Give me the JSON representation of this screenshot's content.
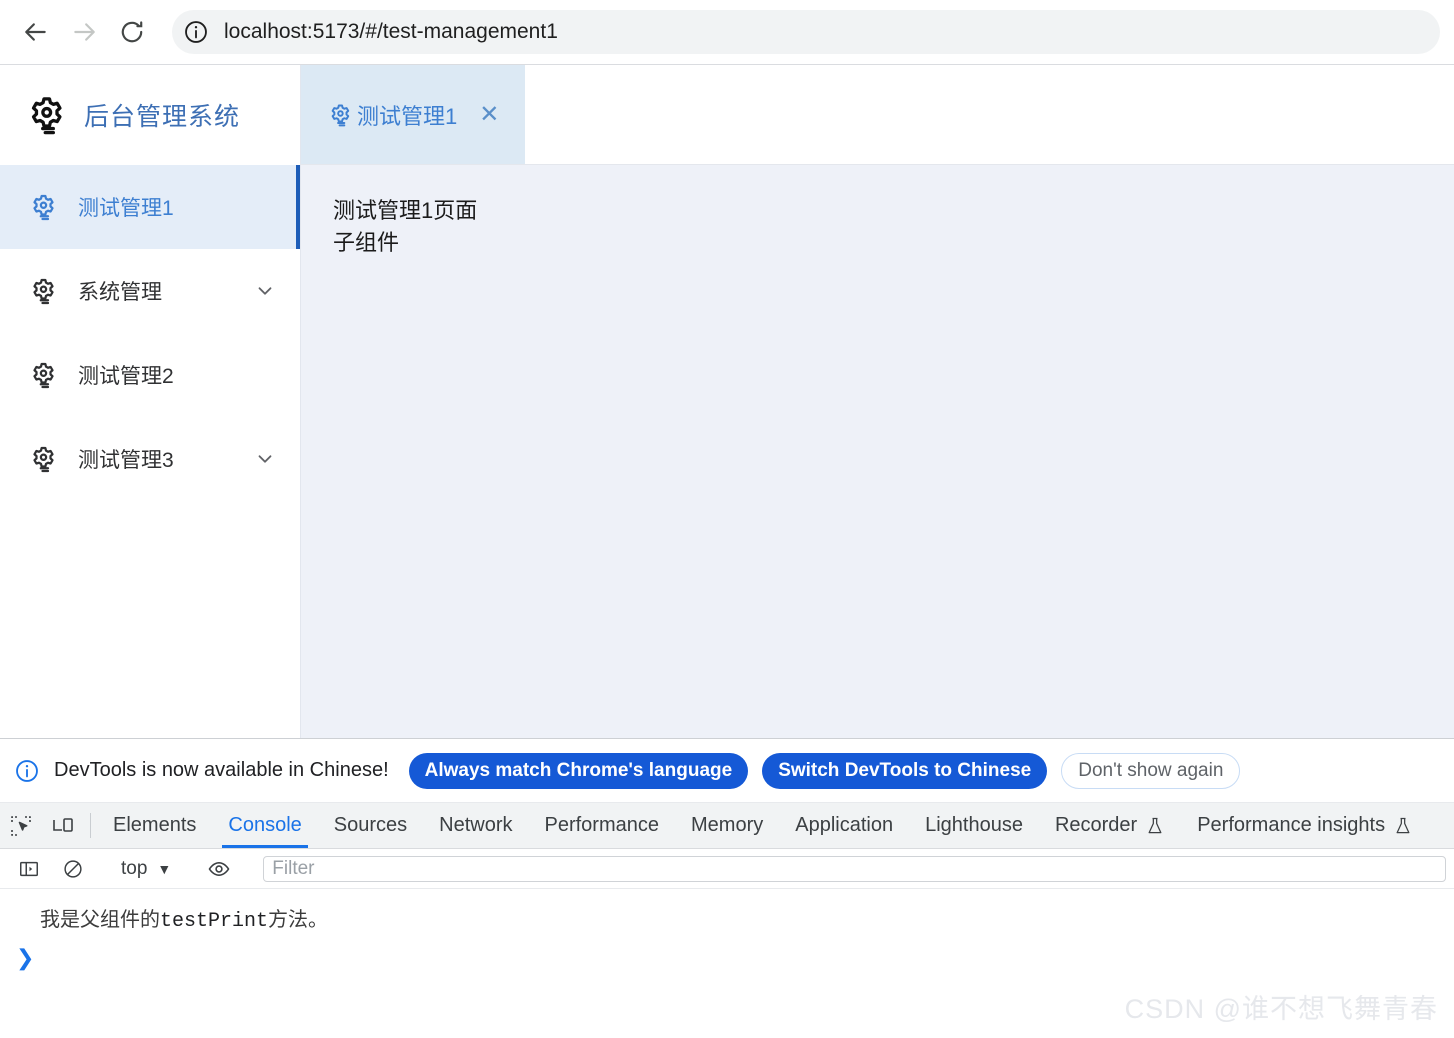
{
  "browser": {
    "back_icon": "arrow-left-icon",
    "forward_icon": "arrow-right-icon",
    "reload_icon": "reload-icon",
    "site_info_icon": "info-circle-icon",
    "url": "localhost:5173/#/test-management1"
  },
  "sidebar": {
    "logo_icon": "gear-settings-icon",
    "title": "后台管理系统",
    "items": [
      {
        "label": "测试管理1",
        "icon": "gear-settings-icon",
        "active": true,
        "has_chevron": false
      },
      {
        "label": "系统管理",
        "icon": "gear-settings-icon",
        "active": false,
        "has_chevron": true
      },
      {
        "label": "测试管理2",
        "icon": "gear-settings-icon",
        "active": false,
        "has_chevron": false
      },
      {
        "label": "测试管理3",
        "icon": "gear-settings-icon",
        "active": false,
        "has_chevron": true
      }
    ]
  },
  "tabs": {
    "items": [
      {
        "label": "测试管理1",
        "icon": "gear-settings-icon",
        "close_label": "✕",
        "active": true
      }
    ]
  },
  "content": {
    "line1": "测试管理1页面",
    "line2": "子组件"
  },
  "devtools": {
    "notice": {
      "icon": "info-circle-icon",
      "text": "DevTools is now available in Chinese!",
      "buttons": [
        {
          "label": "Always match Chrome's language",
          "style": "primary"
        },
        {
          "label": "Switch DevTools to Chinese",
          "style": "primary"
        },
        {
          "label": "Don't show again",
          "style": "ghost"
        }
      ]
    },
    "left_icons": [
      {
        "name": "inspect-element-icon"
      },
      {
        "name": "device-toolbar-icon"
      }
    ],
    "panels": [
      {
        "label": "Elements",
        "active": false,
        "experimental": false
      },
      {
        "label": "Console",
        "active": true,
        "experimental": false
      },
      {
        "label": "Sources",
        "active": false,
        "experimental": false
      },
      {
        "label": "Network",
        "active": false,
        "experimental": false
      },
      {
        "label": "Performance",
        "active": false,
        "experimental": false
      },
      {
        "label": "Memory",
        "active": false,
        "experimental": false
      },
      {
        "label": "Application",
        "active": false,
        "experimental": false
      },
      {
        "label": "Lighthouse",
        "active": false,
        "experimental": false
      },
      {
        "label": "Recorder",
        "active": false,
        "experimental": true
      },
      {
        "label": "Performance insights",
        "active": false,
        "experimental": true
      }
    ],
    "console_toolbar": {
      "sidebar_icon": "console-sidebar-icon",
      "clear_icon": "clear-console-icon",
      "context": "top",
      "context_chevron": "▼",
      "eye_icon": "eye-icon",
      "filter_placeholder": "Filter",
      "filter_value": ""
    },
    "console_output": {
      "message_prefix": "我是父组件的",
      "message_mono": "testPrint",
      "message_suffix": "方法。",
      "prompt": "❯"
    }
  },
  "watermark": {
    "text": "CSDN @谁不想飞舞青春"
  },
  "colors": {
    "accent_blue": "#1a73e8",
    "app_blue": "#3d7fd1",
    "sidebar_active_bg": "#e4edf8",
    "tab_active_bg": "#dce9f4",
    "content_bg": "#eef1f8"
  }
}
